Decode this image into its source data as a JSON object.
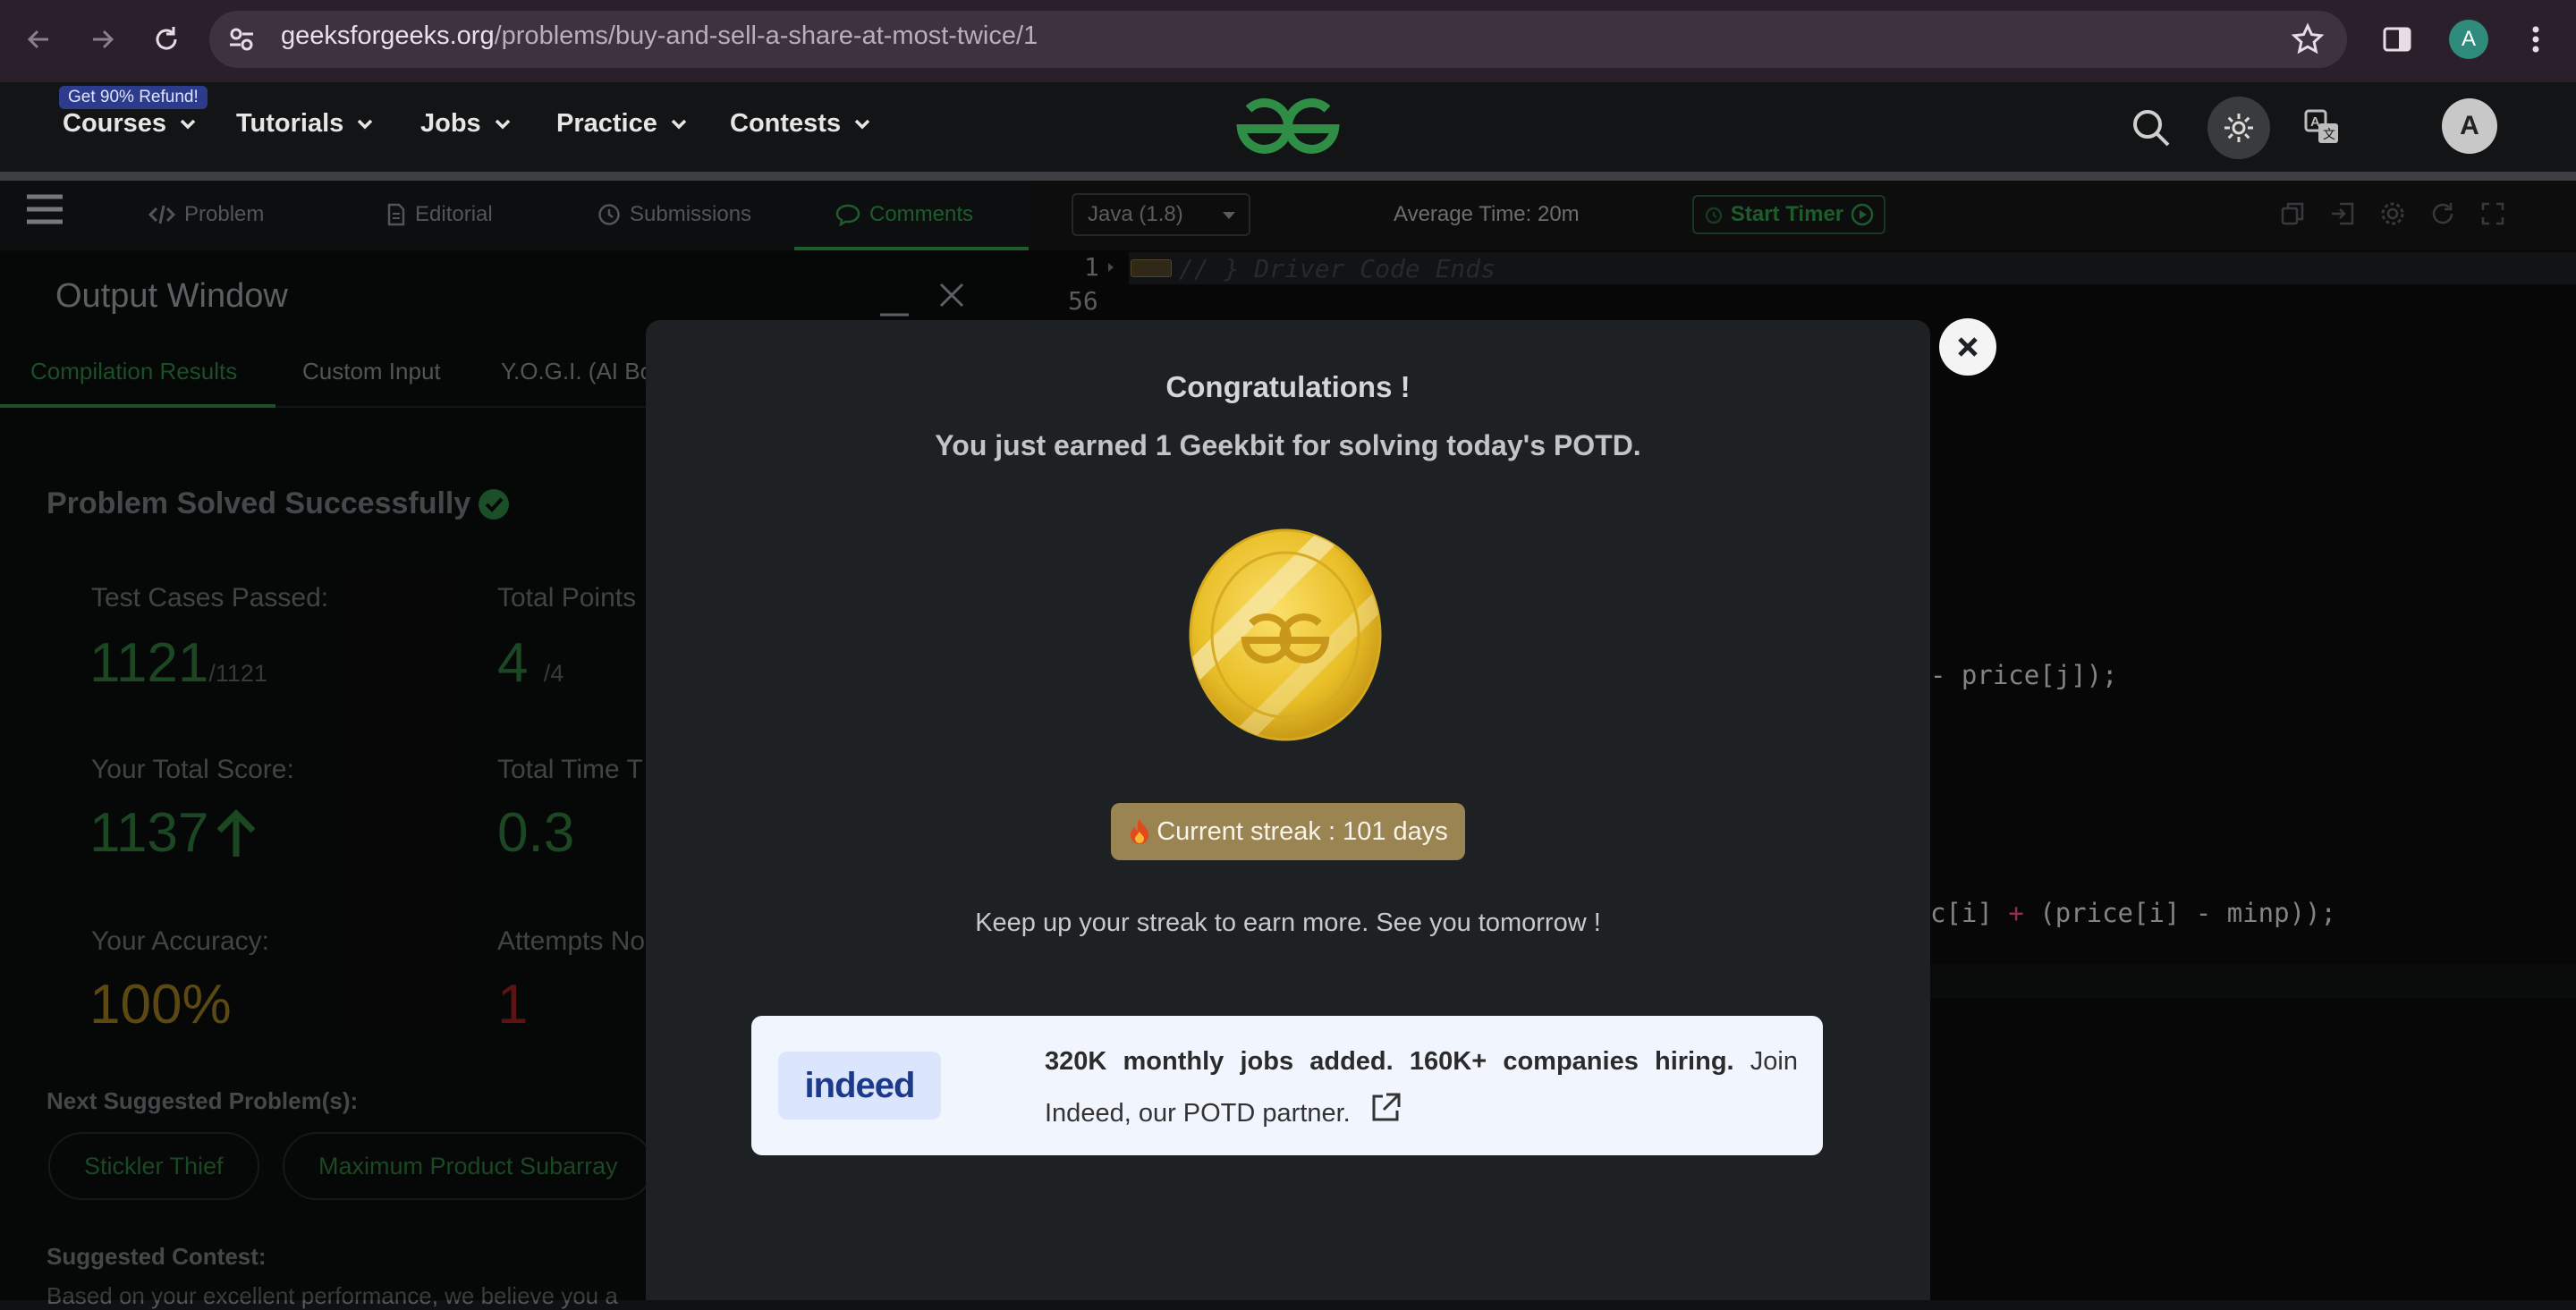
{
  "browser": {
    "url_host": "geeksforgeeks.org",
    "url_path": "/problems/buy-and-sell-a-share-at-most-twice/1",
    "profile_initial": "A"
  },
  "nav": {
    "refund_badge": "Get 90% Refund!",
    "items": [
      "Courses",
      "Tutorials",
      "Jobs",
      "Practice",
      "Contests"
    ],
    "avatar_initial": "A"
  },
  "tabs": [
    "Problem",
    "Editorial",
    "Submissions",
    "Comments"
  ],
  "output": {
    "title": "Output Window",
    "tabs": [
      "Compilation Results",
      "Custom Input",
      "Y.O.G.I. (AI Bo"
    ],
    "solved": "Problem Solved Successfully",
    "test_cases_label": "Test Cases Passed:",
    "test_cases_value": "1121",
    "test_cases_total": "/1121",
    "points_label": "Total Points",
    "points_value": "4",
    "points_total": "/4",
    "score_label": "Your Total Score:",
    "score_value": "1137",
    "time_label": "Total Time T",
    "time_value": "0.3",
    "accuracy_label": "Your Accuracy:",
    "accuracy_value": "100%",
    "attempts_label": "Attempts No",
    "attempts_value": "1",
    "next_label": "Next Suggested Problem(s):",
    "next_problems": [
      "Stickler Thief",
      "Maximum Product Subarray"
    ],
    "contest_label": "Suggested Contest:",
    "contest_text": "Based on your excellent performance, we believe you a"
  },
  "editor": {
    "language": "Java (1.8)",
    "avg_time": "Average Time: 20m",
    "start_timer": "Start Timer",
    "line_numbers": [
      "1",
      "56"
    ],
    "comment": "// } Driver Code Ends",
    "code_line_a": "- price[j]);",
    "code_line_b_pre": "c[i] ",
    "code_line_b_op": "+",
    "code_line_b_post": " (price[i] - minp));"
  },
  "modal": {
    "title": "Congratulations !",
    "earned": "You just earned 1 Geekbit for solving today's POTD.",
    "streak": "Current streak : 101 days",
    "keep_up": "Keep up your streak to earn more. See you tomorrow !",
    "ad_logo": "indeed",
    "ad_bold": "320K monthly jobs added. 160K+ companies hiring.",
    "ad_rest": " Join Indeed, our POTD partner."
  },
  "colors": {
    "brand_green": "#2f8d46",
    "streak_bg": "#9a8452",
    "ad_bg": "#f1f5fd"
  }
}
